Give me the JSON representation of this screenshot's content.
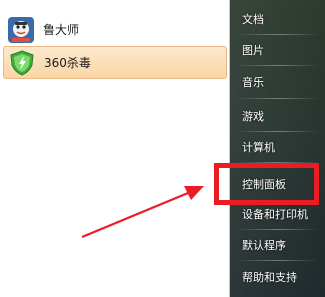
{
  "recent_programs": [
    {
      "label": "鲁大师",
      "icon": "ludashi-icon"
    },
    {
      "label": "360杀毒",
      "icon": "360-antivirus-icon"
    }
  ],
  "places": [
    {
      "label": "文档"
    },
    {
      "label": "图片"
    },
    {
      "label": "音乐"
    },
    {
      "label": "游戏"
    },
    {
      "label": "计算机"
    },
    {
      "label": "控制面板"
    },
    {
      "label": "设备和打印机"
    },
    {
      "label": "默认程序"
    },
    {
      "label": "帮助和支持"
    }
  ],
  "annotation": {
    "highlight_color": "#ec1c24",
    "highlighted_item": "控制面板"
  },
  "colors": {
    "selected_item_bg": "#f9d6a6",
    "right_pane_bg": "#283530"
  }
}
